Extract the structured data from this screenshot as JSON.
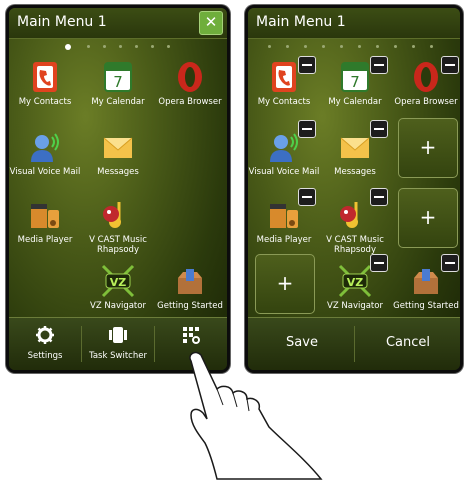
{
  "left_screen": {
    "title": "Main Menu 1",
    "close_label": "✕",
    "apps": {
      "contacts": "My Contacts",
      "calendar": "My Calendar",
      "calendar_day": "7",
      "opera": "Opera Browser",
      "voicemail": "Visual Voice Mail",
      "messages": "Messages",
      "mediaplayer": "Media Player",
      "vcast": "V CAST Music Rhapsody",
      "navigator": "VZ Navigator",
      "getstarted": "Getting Started"
    },
    "toolbar": {
      "settings": "Settings",
      "taskswitcher": "Task Switcher"
    }
  },
  "right_screen": {
    "title": "Main Menu 1",
    "apps": {
      "contacts": "My Contacts",
      "calendar": "My Calendar",
      "calendar_day": "7",
      "opera": "Opera Browser",
      "voicemail": "Visual Voice Mail",
      "messages": "Messages",
      "mediaplayer": "Media Player",
      "vcast": "V CAST Music Rhapsody",
      "navigator": "VZ Navigator",
      "getstarted": "Getting Started"
    },
    "add_symbol": "+",
    "softkeys": {
      "save": "Save",
      "cancel": "Cancel"
    }
  },
  "colors": {
    "screen_bg": "#4a5b18",
    "accent_green": "#6fae3c",
    "calendar_red": "#c9271b"
  }
}
